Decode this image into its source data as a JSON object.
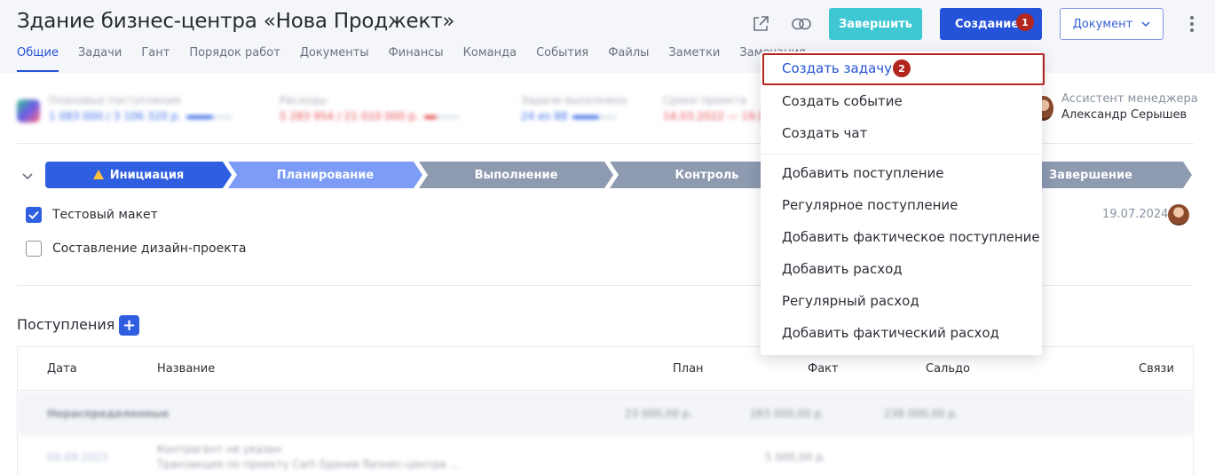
{
  "header": {
    "title": "Здание бизнес-центра «Нова Проджект»",
    "external_icon": "external-link-icon",
    "link_icon": "link-icon",
    "finish_label": "Завершить",
    "create_label": "Создание",
    "create_badge": "1",
    "document_label": "Документ",
    "more_icon": "vertical-dots-icon"
  },
  "tabs": [
    {
      "label": "Общие",
      "active": true
    },
    {
      "label": "Задачи"
    },
    {
      "label": "Гант"
    },
    {
      "label": "Порядок работ"
    },
    {
      "label": "Документы"
    },
    {
      "label": "Финансы"
    },
    {
      "label": "Команда"
    },
    {
      "label": "События"
    },
    {
      "label": "Файлы"
    },
    {
      "label": "Заметки"
    },
    {
      "label": "Замечания"
    }
  ],
  "stats": [
    {
      "label": "Плановые поступления",
      "value": "1 083 000 / 3 106 320 р.",
      "color": "#3b6ae8"
    },
    {
      "label": "Расходы",
      "value": "5 283 954 / 21 010 000 р.",
      "color": "#e5484d"
    },
    {
      "label": "Задачи выполнено",
      "value": "24 из 88",
      "color": "#3b6ae8"
    },
    {
      "label": "Сроки проекта",
      "value": "14.03.2022 — 19.07.2024",
      "color": "#e5484d"
    }
  ],
  "assistant": {
    "role": "Ассистент менеджера",
    "name": "Александр Серышев"
  },
  "stages": [
    {
      "label": "Инициация",
      "warning": true
    },
    {
      "label": "Планирование"
    },
    {
      "label": "Выполнение"
    },
    {
      "label": "Контроль"
    },
    {
      "label": "Завершение"
    }
  ],
  "checklist": [
    {
      "label": "Тестовый макет",
      "checked": true,
      "date": "19.07.2024"
    },
    {
      "label": "Составление дизайн-проекта",
      "checked": false
    }
  ],
  "income": {
    "title": "Поступления",
    "add_label": "+",
    "columns": [
      "Дата",
      "Название",
      "План",
      "Факт",
      "Сальдо",
      "Связи"
    ],
    "group_row": {
      "name": "Нераспределенные",
      "plan": "23 000,00 р.",
      "fact": "283 000,00 р.",
      "saldo": "238 000,00 р."
    },
    "row": {
      "date": "09.09.2023",
      "title": "Контрагент не указан",
      "subtitle": "Транзакция по проекту Cart-Здание бизнес-центра ...",
      "fact": "5 000,00 р."
    }
  },
  "menu": {
    "items": [
      {
        "label": "Создать задачу",
        "highlight": true,
        "badge": "2"
      },
      {
        "label": "Создать событие"
      },
      {
        "label": "Создать чат"
      },
      {
        "label": "Добавить поступление"
      },
      {
        "label": "Регулярное поступление"
      },
      {
        "label": "Добавить фактическое поступление"
      },
      {
        "label": "Добавить расход"
      },
      {
        "label": "Регулярный расход"
      },
      {
        "label": "Добавить фактический расход"
      }
    ]
  },
  "colors": {
    "primary": "#2452d9",
    "finish": "#3fc8d3",
    "annotation": "#b3261e"
  }
}
